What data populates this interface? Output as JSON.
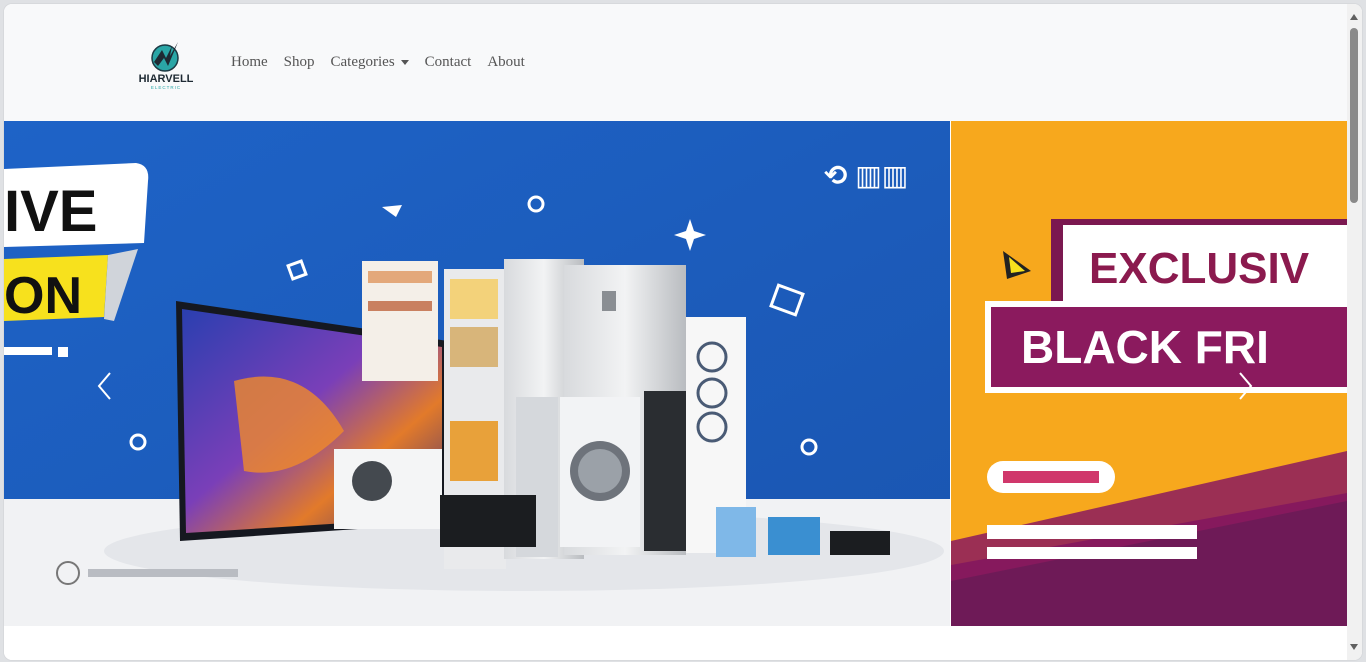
{
  "brand": {
    "name": "HIARVELL",
    "tagline": "ELECTRIC",
    "icon": "lightning-logo-icon"
  },
  "nav": {
    "items": [
      {
        "label": "Home"
      },
      {
        "label": "Shop"
      },
      {
        "label": "Categories",
        "dropdown": true
      },
      {
        "label": "Contact"
      },
      {
        "label": "About"
      }
    ]
  },
  "carousel": {
    "slides": [
      {
        "headline_top": "IVE",
        "headline_bottom": "ON",
        "colors": {
          "background": "#1d5fbf",
          "accent": "#f7e11d"
        }
      },
      {
        "headline_top": "EXCLUSIV",
        "headline_bottom": "BLACK FRI",
        "colors": {
          "background": "#f7a81d",
          "accent": "#8b1a5e"
        }
      }
    ],
    "prev_icon": "chevron-left-icon",
    "next_icon": "chevron-right-icon"
  },
  "colors": {
    "navbar_bg": "#f8f9fa",
    "nav_link": "#555555"
  }
}
